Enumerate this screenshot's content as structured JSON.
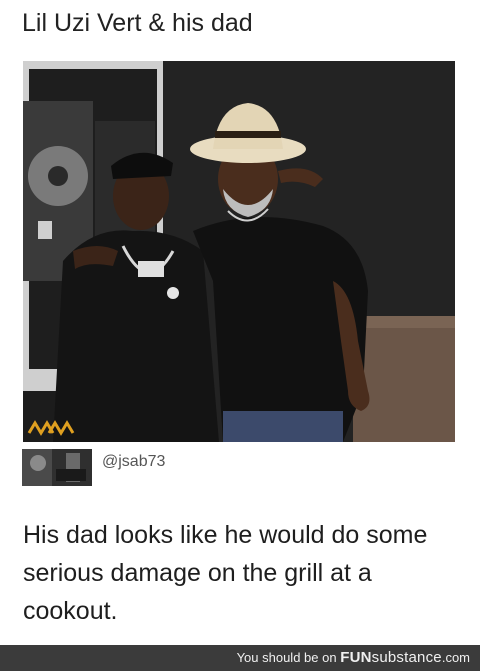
{
  "post": {
    "title": "Lil Uzi Vert & his dad",
    "comment": {
      "handle": "@jsab73",
      "text": "His dad looks like he would do some serious damage on the grill at a cookout."
    }
  },
  "footer": {
    "prefix": "You should be on",
    "brand_bold": "FUN",
    "brand_rest": "substance",
    "domain": ".com"
  }
}
